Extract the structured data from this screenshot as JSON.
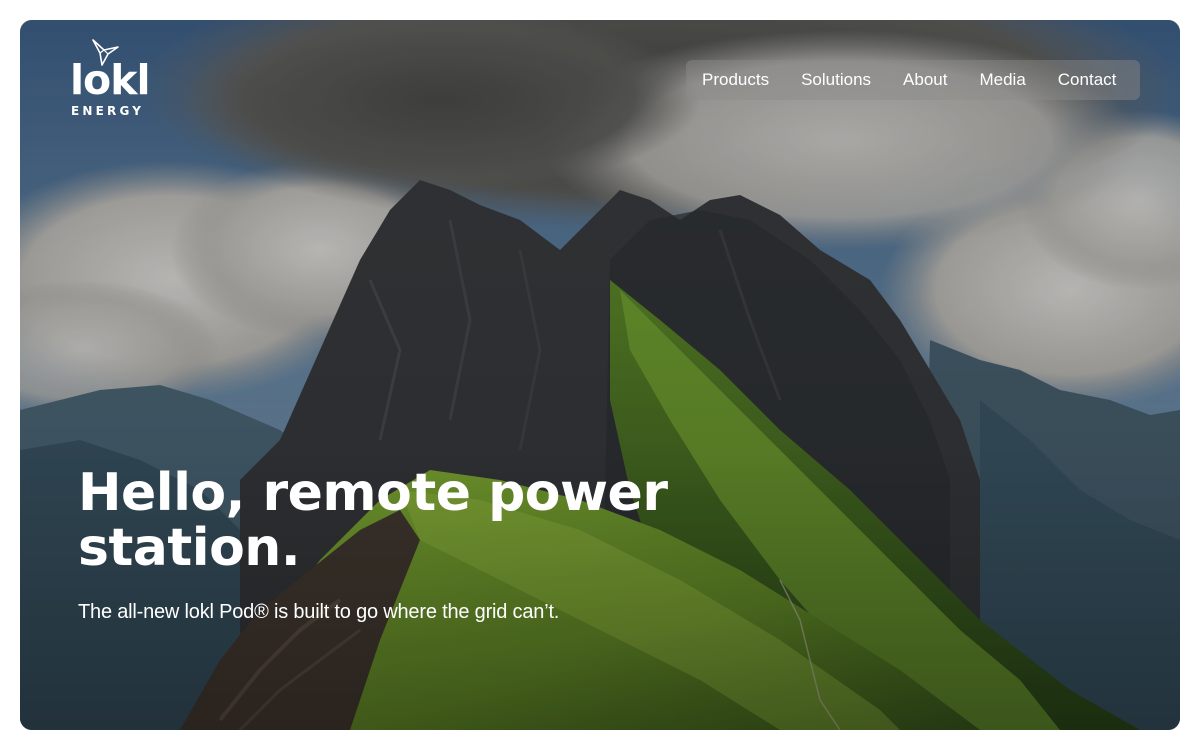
{
  "brand": {
    "name": "lokl",
    "tagline": "ENERGY",
    "icon": "bird-icon"
  },
  "nav": {
    "items": [
      {
        "label": "Products"
      },
      {
        "label": "Solutions"
      },
      {
        "label": "About"
      },
      {
        "label": "Media"
      },
      {
        "label": "Contact"
      }
    ]
  },
  "hero": {
    "headline": "Hello, remote power station.",
    "subtext": "The all-new lokl Pod® is built to go where the grid can’t.",
    "background": "mountain-landscape-image"
  },
  "colors": {
    "text": "#ffffff",
    "nav_background": "rgba(140,140,140,0.45)",
    "grass": "#7aa830",
    "rock": "#3a3d40",
    "sky": "#5f85a8",
    "cloud": "#c8c8c6"
  }
}
